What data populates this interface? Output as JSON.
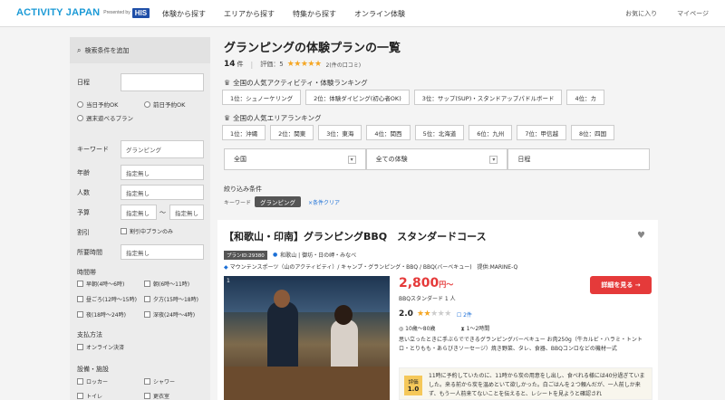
{
  "header": {
    "logo": {
      "main_a": "ACTIVITY JAPAN",
      "sub": "Presented by",
      "brand": "HIS"
    },
    "nav": [
      "体験から探す",
      "エリアから探す",
      "特集から探す",
      "オンライン体験"
    ],
    "right": [
      "お気に入り",
      "マイページ"
    ]
  },
  "sidebar": {
    "heading": "検索条件を追加",
    "date_label": "日程",
    "radios": [
      "当日予約OK",
      "前日予約OK",
      "週末遊べるプラン"
    ],
    "keyword_label": "キーワード",
    "keyword_value": "グランピング",
    "age_label": "年齢",
    "age_value": "指定無し",
    "people_label": "人数",
    "people_value": "指定無し",
    "budget_label": "予算",
    "budget_from": "指定無し",
    "budget_sep": "～",
    "budget_to": "指定無し",
    "discount_label": "割引",
    "discount_option": "割引中プランのみ",
    "duration_label": "所要時間",
    "duration_value": "指定無し",
    "timeslot_label": "時間帯",
    "timeslots": [
      "早朝(4時〜6時)",
      "朝(6時〜11時)",
      "昼ごろ(12時〜15時)",
      "夕方(15時〜18時)",
      "夜(18時〜24時)",
      "深夜(24時〜4時)"
    ],
    "payment_label": "支払方法",
    "payment_option": "オンライン決済",
    "facility_label": "設備・施設",
    "facilities": [
      "ロッカー",
      "シャワー",
      "トイレ",
      "更衣室"
    ]
  },
  "main": {
    "title": "グランピングの体験プランの一覧",
    "count": "14",
    "count_unit": "件",
    "rating_label": "評価：5",
    "stars": "★★★★★",
    "review_count": "2(件の口コミ)",
    "activity_ranking_title": "全国の人気アクティビティ・体験ランキング",
    "activity_ranking": [
      "1位：シュノーケリング",
      "2位：体験ダイビング(初心者OK)",
      "3位：サップ(SUP)・スタンドアップパドルボード",
      "4位：カ"
    ],
    "area_ranking_title": "全国の人気エリアランキング",
    "area_ranking": [
      "1位：沖縄",
      "2位：関東",
      "3位：東海",
      "4位：関西",
      "5位：北海道",
      "6位：九州",
      "7位：甲信越",
      "8位：四国"
    ],
    "selects": [
      "全国",
      "全ての体験",
      "日程"
    ],
    "filter_title": "絞り込み条件",
    "filter_kw_label": "キーワード",
    "filter_kw_value": "グランピング",
    "filter_clear": "×条件クリア"
  },
  "card": {
    "title": "【和歌山・印南】グランピングBBQ　スタンダードコース",
    "plan_id": "プランID:29380",
    "location": "和歌山 | 御坊・日の岬・みなべ",
    "category": "マウンテンスポーツ（山のアクティビティ）/ キャンプ・グランピング・BBQ / BBQ(バーベキュー)　提供:MARINE-Q",
    "photo_num": "1",
    "price": "2,800",
    "price_unit": "円～",
    "price_sub": "BBQスタンダード 1 人",
    "detail_button": "詳細を見る →",
    "rating": "2.0",
    "stars_on": "★★",
    "stars_off": "★★★",
    "review_link": "2件",
    "age_info": "10歳〜80歳",
    "time_info": "1〜2時間",
    "description": "思い立ったときに手ぶらでできるグランピングバーベキュー お肉250g（牛カルビ・ハラミ・トントロ・とりもも・あらびきソーセージ）焼き野菜、タレ、食器、BBQコンロなどの機材一式",
    "review_badge_label": "評価",
    "review_badge_value": "1.0",
    "review_text": "11時に予約していたのに、11時から炭の用意をし出し、食べれる様には40分過ぎていました。来る前から炭を温めといて欲しかった。白ごはんを２つ頼んだが、一人前しか来ず、もう一人前来てないことを伝えると、レシートを見ようと確認され"
  }
}
